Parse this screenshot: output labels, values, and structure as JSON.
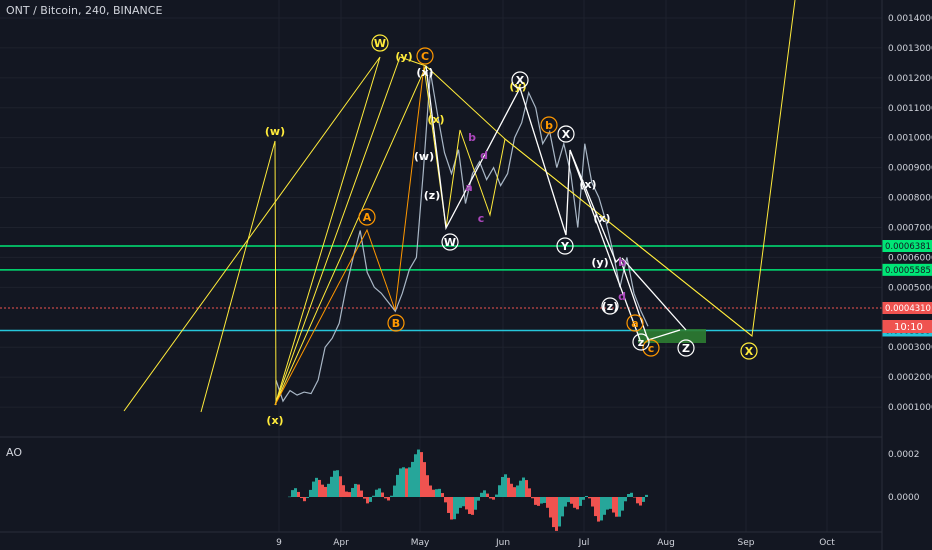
{
  "header": {
    "title": "ONT / Bitcoin, 240, BINANCE"
  },
  "ao_panel": {
    "label": "AO",
    "ticks": [
      "0.0002",
      "0.0000"
    ]
  },
  "chart_data": {
    "type": "line",
    "title": "ONT / Bitcoin, 240, BINANCE",
    "ylim": [
      0.0,
      0.00146
    ],
    "x_labels": [
      "9",
      "Apr",
      "May",
      "Jun",
      "Jul",
      "Aug",
      "Sep",
      "Oct"
    ],
    "y_ticks": [
      "0.0014000",
      "0.0013000",
      "0.0012000",
      "0.0011000",
      "0.0010000",
      "0.0009000",
      "0.0008000",
      "0.0007000",
      "0.0006000",
      "0.0005000",
      "0.0003000",
      "0.0002000",
      "0.0001000"
    ],
    "horizontal_levels": [
      {
        "value": 0.0006381,
        "label": "0.0006381",
        "color": "#00e676"
      },
      {
        "value": 0.0005585,
        "label": "0.0005585",
        "color": "#00e676"
      },
      {
        "value": 0.000431,
        "label": "0.0004310",
        "color": "#ef5350"
      },
      {
        "value": 0.0003559,
        "label": "0.0003559",
        "color": "#26c6da"
      }
    ],
    "countdown": "10:10",
    "price_series_color": "#a9b7c6",
    "price": [
      [
        "x",
        0.00019
      ],
      [
        "x",
        0.00012
      ],
      [
        "x",
        0.000155
      ],
      [
        "x",
        0.00014
      ],
      [
        "x",
        0.00015
      ],
      [
        "x",
        0.000145
      ],
      [
        "x",
        0.00019
      ],
      [
        "x",
        0.0003
      ],
      [
        "x",
        0.00033
      ],
      [
        "Apr",
        0.00038
      ],
      [
        "Apr",
        0.0005
      ],
      [
        "Apr",
        0.0006
      ],
      [
        "Apr",
        0.00069
      ],
      [
        "Apr",
        0.00055
      ],
      [
        "Apr",
        0.0005
      ],
      [
        "Apr",
        0.00048
      ],
      [
        "Apr",
        0.00045
      ],
      [
        "Apr",
        0.00042
      ],
      [
        "Apr",
        0.00048
      ],
      [
        "Apr",
        0.00056
      ],
      [
        "Apr",
        0.0006
      ],
      [
        "May",
        0.00089
      ],
      [
        "May",
        0.00122
      ],
      [
        "May",
        0.00108
      ],
      [
        "May",
        0.00095
      ],
      [
        "May",
        0.00088
      ],
      [
        "May",
        0.00096
      ],
      [
        "May",
        0.00078
      ],
      [
        "May",
        0.00088
      ],
      [
        "May",
        0.00092
      ],
      [
        "May",
        0.00086
      ],
      [
        "May",
        0.0009
      ],
      [
        "May",
        0.00084
      ],
      [
        "May",
        0.00088
      ],
      [
        "Jun",
        0.001
      ],
      [
        "Jun",
        0.00105
      ],
      [
        "Jun",
        0.00115
      ],
      [
        "Jun",
        0.0011
      ],
      [
        "Jun",
        0.00098
      ],
      [
        "Jun",
        0.00102
      ],
      [
        "Jun",
        0.0009
      ],
      [
        "Jun",
        0.00098
      ],
      [
        "Jun",
        0.00088
      ],
      [
        "Jun",
        0.0007
      ],
      [
        "Jul",
        0.00098
      ],
      [
        "Jul",
        0.00085
      ],
      [
        "Jul",
        0.0008
      ],
      [
        "Jul",
        0.00072
      ],
      [
        "Jul",
        0.00062
      ],
      [
        "Jul",
        0.0005
      ],
      [
        "Jul",
        0.0006
      ],
      [
        "Jul",
        0.00048
      ],
      [
        "Jul",
        0.00042
      ],
      [
        "Jul",
        0.00037
      ]
    ],
    "annotation_color_wxy": "#ffeb3b",
    "annotation_color_abc": "#ff9800",
    "annotation_color_white": "#ffffff",
    "annotation_color_purple": "#ab47bc",
    "wave_labels_yellow": [
      "(w)",
      "W",
      "(y)",
      "(x)",
      "(y)",
      "X",
      "(x)"
    ],
    "wave_labels_orange": [
      "A",
      "B",
      "C",
      "a",
      "b",
      "c"
    ],
    "wave_labels_white": [
      "(x)",
      "X",
      "W",
      "Y",
      "X",
      "Z",
      "(w)",
      "(x)",
      "(z)",
      "(x)",
      "(y)",
      "(z)",
      "z"
    ],
    "wave_labels_purple": [
      "a",
      "b",
      "c",
      "d",
      "b",
      "d"
    ],
    "target_zone_color": "#2e7d32",
    "ao_histogram_up_color": "#26a69a",
    "ao_histogram_down_color": "#ef5350"
  }
}
